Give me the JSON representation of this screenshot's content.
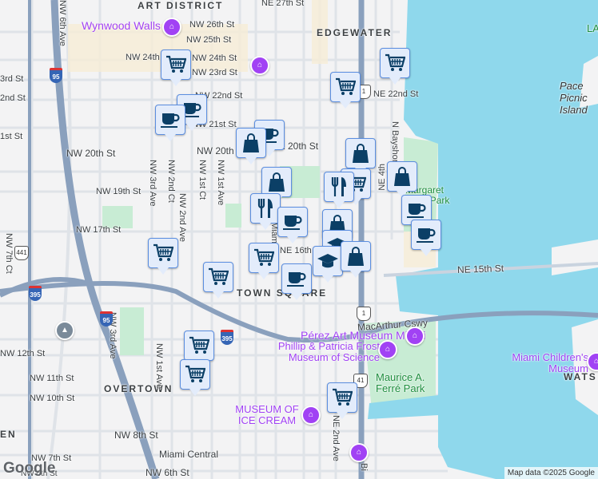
{
  "neighborhoods": {
    "art_district": "ART DISTRICT",
    "edgewater": "EDGEWATER",
    "town_square": "TOWN SQUARE",
    "overtown": "OVERTOWN",
    "watson": "WATS",
    "en": "EN",
    "la": "LA"
  },
  "streets": {
    "nw27": "NE 27th St",
    "nw26": "NW 26th St",
    "nw25": "NW 25th St",
    "nw24a": "NW 24th St",
    "nw24b": "NW 24th St",
    "nw23": "NW 23rd St",
    "nw22": "NW 22nd St",
    "nw21": "NW 21st St",
    "nw20": "NW 20th St",
    "nw20b": "NW 20th St",
    "nw19": "NW 19th St",
    "nw17": "NW 17th St",
    "ne22": "NE 22nd St",
    "ne16": "NE 16th St",
    "ne15": "NE 15th St",
    "nw12": "NW 12th St",
    "nw11": "NW 11th St",
    "nw10": "NW 10th St",
    "nw8": "NW 8th St",
    "nw7": "NW 7th St",
    "nw6": "NW 6th St",
    "ne20": "NE 20th St",
    "rd3": "3rd St",
    "nd2": "2nd St",
    "st1": "1st St",
    "nw6ave": "NW 6th Ave",
    "nw7ct": "NW 7th Ct",
    "nw3ave": "NW 3rd Ave",
    "nw2ct": "NW 2nd Ct",
    "nw2ave": "NW 2nd Ave",
    "nw1ct": "NW 1st Ct",
    "nw1ave": "NW 1st Ave",
    "nw3ave_s": "NW 3rd Ave",
    "nw1ave_s": "NW 1st Ave",
    "nbayshore": "N Bayshore",
    "ne4th": "NE 4th",
    "miami": "Miami",
    "ne2ave": "NE 2nd Ave",
    "bisc": "Bi",
    "macarthur": "MacArthur Cswy"
  },
  "places": {
    "wynwood": "Wynwood Walls",
    "pace": "Pace Picnic Island",
    "margaret": "Margaret Pace Park",
    "perez": "Pérez Art Museum Miami",
    "frost": "Phillip & Patricia Frost Museum of Science",
    "childrens": "Miami Children's Museum",
    "ferre": "Maurice A. Ferré Park",
    "icecream": "MUSEUM OF ICE CREAM",
    "central": "Miami Central"
  },
  "shields": {
    "i95": "95",
    "i95b": "95",
    "i395": "395",
    "i395b": "395",
    "us1": "1",
    "us1b": "1",
    "us41": "41",
    "us441": "441"
  },
  "markers": [
    "cart",
    "cart",
    "cart",
    "cup",
    "cup",
    "cup",
    "bag",
    "bag",
    "bag",
    "cart",
    "fork",
    "bag",
    "cup",
    "cup",
    "fork",
    "cup",
    "bag",
    "grad",
    "grad",
    "bag",
    "cart",
    "cart",
    "cart",
    "cup",
    "cart",
    "cart",
    "cart"
  ],
  "footer": {
    "logo": "Google",
    "attribution": "Map data ©2025 Google"
  },
  "colors": {
    "water": "#8fd8ec",
    "highway": "#8aa0bd",
    "park": "#c8ecd4",
    "marker_bg": "#e3ecfb",
    "marker_icon": "#0b3f66",
    "poi": "#a142f4"
  }
}
